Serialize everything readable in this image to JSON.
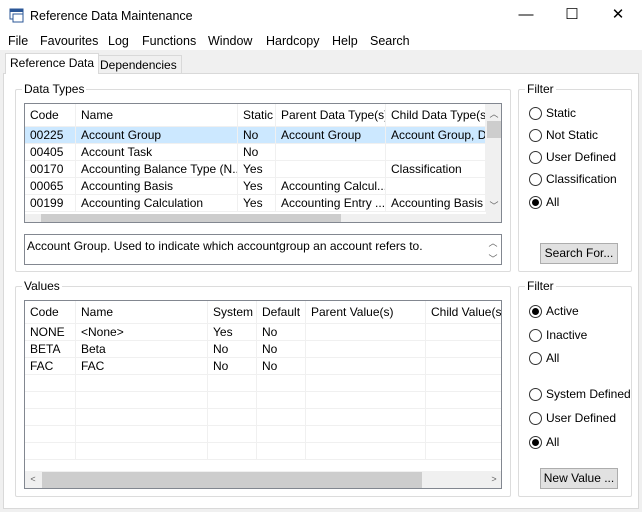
{
  "window": {
    "title": "Reference Data Maintenance",
    "minimize": "—",
    "maximize": "☐",
    "close": "✕"
  },
  "menu": [
    "File",
    "Favourites",
    "Log",
    "Functions",
    "Window",
    "Hardcopy",
    "Help",
    "Search"
  ],
  "tabs": [
    {
      "label": "Reference Data",
      "active": true
    },
    {
      "label": "Dependencies",
      "active": false
    }
  ],
  "data_types": {
    "title": "Data Types",
    "columns": [
      "Code",
      "Name",
      "Static",
      "Parent Data Type(s)",
      "Child Data Type(s)"
    ],
    "rows": [
      [
        "00225",
        "Account Group",
        "No",
        "Account Group",
        "Account Group, D..."
      ],
      [
        "00405",
        "Account Task",
        "No",
        "",
        ""
      ],
      [
        "00170",
        "Accounting Balance Type (N...",
        "Yes",
        "",
        "Classification"
      ],
      [
        "00065",
        "Accounting Basis",
        "Yes",
        "Accounting Calcul...",
        ""
      ],
      [
        "00199",
        "Accounting Calculation",
        "Yes",
        "Accounting Entry ...",
        "Accounting Basis"
      ]
    ],
    "selected_row": 0,
    "description": "Account Group. Used to indicate which accountgroup an account refers to."
  },
  "filter1": {
    "title": "Filter",
    "options": [
      "Static",
      "Not Static",
      "User Defined",
      "Classification",
      "All"
    ],
    "selected": "All",
    "button": "Search For..."
  },
  "values": {
    "title": "Values",
    "columns": [
      "Code",
      "Name",
      "System",
      "Default",
      "Parent Value(s)",
      "Child Value(s)"
    ],
    "rows": [
      [
        "NONE",
        "<None>",
        "Yes",
        "No",
        "",
        ""
      ],
      [
        "BETA",
        "Beta",
        "No",
        "No",
        "",
        ""
      ],
      [
        "FAC",
        "FAC",
        "No",
        "No",
        "",
        ""
      ]
    ]
  },
  "filter2": {
    "title": "Filter",
    "status_options": [
      "Active",
      "Inactive",
      "All"
    ],
    "status_selected": "Active",
    "source_options": [
      "System Defined",
      "User Defined",
      "All"
    ],
    "source_selected": "All",
    "button": "New Value ..."
  }
}
